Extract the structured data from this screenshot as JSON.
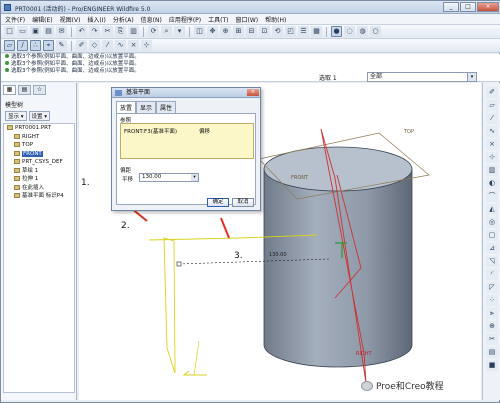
{
  "window": {
    "title": "PRT0001 (活动的) - Pro/ENGINEER Wildfire 5.0",
    "min": "_",
    "max": "□",
    "close": "×"
  },
  "menu": [
    "文件(F)",
    "编辑(E)",
    "视图(V)",
    "插入(I)",
    "分析(A)",
    "信息(N)",
    "应用程序(P)",
    "工具(T)",
    "窗口(W)",
    "帮助(H)"
  ],
  "messages": [
    "选取3个参照(例如平面、曲面、边或点)以放置平面。",
    "选取3个参照(例如平面、曲面、边或点)以放置平面。",
    "选取3个参照(例如平面、曲面、边或点)以放置平面。",
    "选取3个参照(例如平面、曲面、边或点)以放置平面。"
  ],
  "filter": {
    "label": "选取 1",
    "value": "全部"
  },
  "nav": {
    "tabs": [
      "▦",
      "▤",
      "☆"
    ],
    "tree_header": "模型树",
    "display_btn": "显示 ▾",
    "settings_btn": "设置 ▾",
    "items": [
      {
        "label": "PRT0001.PRT",
        "indent": 0,
        "selected": false
      },
      {
        "label": "RIGHT",
        "indent": 1,
        "selected": false
      },
      {
        "label": "TOP",
        "indent": 1,
        "selected": false
      },
      {
        "label": "FRONT",
        "indent": 1,
        "selected": true
      },
      {
        "label": "PRT_CSYS_DEF",
        "indent": 1,
        "selected": false
      },
      {
        "label": "草绘 1",
        "indent": 1,
        "selected": false
      },
      {
        "label": "拉伸 1",
        "indent": 1,
        "selected": false
      },
      {
        "label": "在此插入",
        "indent": 1,
        "selected": false
      },
      {
        "label": "基准平面 标识P4",
        "indent": 1,
        "selected": false
      }
    ]
  },
  "dialog": {
    "title": "基准平面",
    "close": "×",
    "tabs": [
      "放置",
      "显示",
      "属性"
    ],
    "refs_label": "参照",
    "ref_item": "FRONT:F3(基准平面)",
    "ref_type": "偏移",
    "offset_label": "偏距",
    "translate_label": "平移",
    "translate_value": "130.00",
    "ok": "确定",
    "cancel": "取消"
  },
  "canvas": {
    "top_label": "TOP",
    "right_label": "RIGHT",
    "front_label": "FRONT",
    "dim_label": "130.00"
  },
  "annotations": [
    "1.",
    "2.",
    "3."
  ],
  "watermark": "Proe和Creo教程"
}
